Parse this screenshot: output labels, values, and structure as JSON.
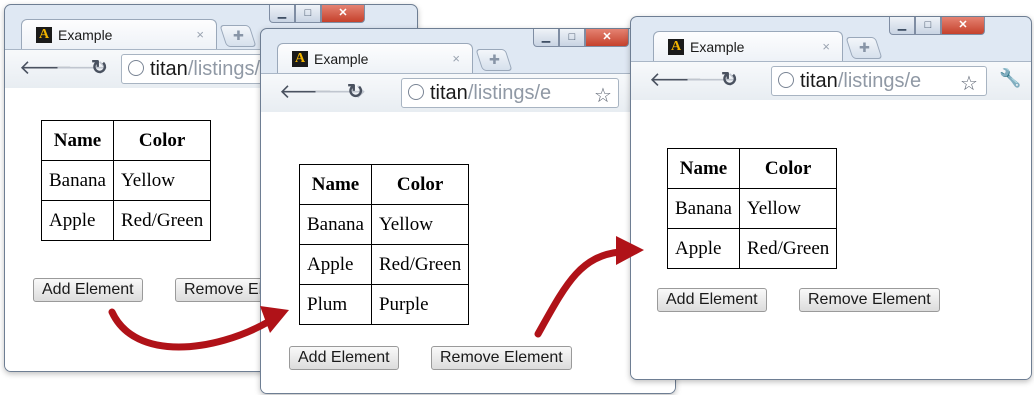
{
  "windows": [
    {
      "tab": {
        "title": "Example",
        "close": "×"
      },
      "url": {
        "host": "titan",
        "path": "/listings/e"
      },
      "table": {
        "headers": [
          "Name",
          "Color"
        ],
        "rows": [
          [
            "Banana",
            "Yellow"
          ],
          [
            "Apple",
            "Red/Green"
          ]
        ]
      },
      "buttons": {
        "add": "Add Element",
        "remove": "Remove Element"
      }
    },
    {
      "tab": {
        "title": "Example",
        "close": "×"
      },
      "url": {
        "host": "titan",
        "path": "/listings/e"
      },
      "table": {
        "headers": [
          "Name",
          "Color"
        ],
        "rows": [
          [
            "Banana",
            "Yellow"
          ],
          [
            "Apple",
            "Red/Green"
          ],
          [
            "Plum",
            "Purple"
          ]
        ]
      },
      "buttons": {
        "add": "Add Element",
        "remove": "Remove Element"
      }
    },
    {
      "tab": {
        "title": "Example",
        "close": "×"
      },
      "url": {
        "host": "titan",
        "path": "/listings/e"
      },
      "table": {
        "headers": [
          "Name",
          "Color"
        ],
        "rows": [
          [
            "Banana",
            "Yellow"
          ],
          [
            "Apple",
            "Red/Green"
          ]
        ]
      },
      "buttons": {
        "add": "Add Element",
        "remove": "Remove Element"
      }
    }
  ],
  "icons": {
    "back": "back-arrow-icon",
    "forward": "forward-arrow-icon",
    "reload": "reload-icon",
    "globe": "globe-icon",
    "star": "bookmark-star-icon",
    "wrench": "wrench-menu-icon",
    "new_tab": "new-tab-icon",
    "logo": "apress-logo-icon"
  },
  "colors": {
    "annotation_arrow": "#b01218",
    "window_frame": "#dfe8f3",
    "close_button": "#c5412c"
  }
}
